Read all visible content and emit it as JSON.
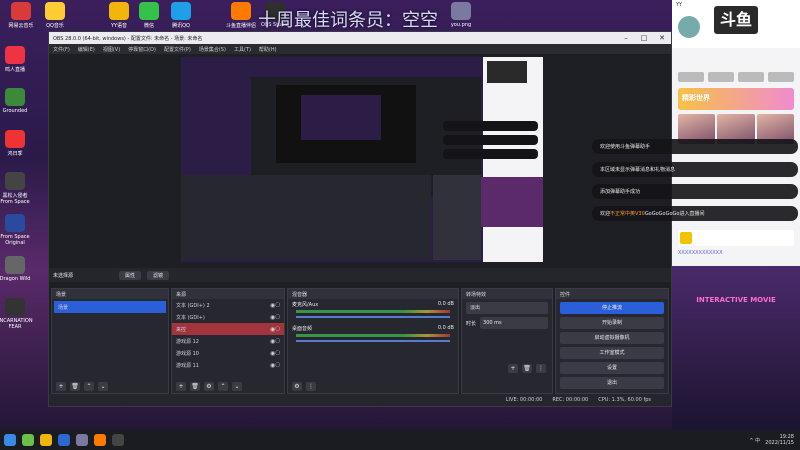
{
  "overlay_title": "十周最佳词条员：空空",
  "desktop_icons": [
    {
      "label": "网易云音乐",
      "color": "#d93a3a"
    },
    {
      "label": "QQ音乐",
      "color": "#ffcc33"
    },
    {
      "label": "YY语音",
      "color": "#f2b50a"
    },
    {
      "label": "微信",
      "color": "#34c24a"
    },
    {
      "label": "腾讯QQ",
      "color": "#1e9fe8"
    },
    {
      "label": "斗鱼直播伴侣",
      "color": "#ff7a00"
    },
    {
      "label": "OBS Studio",
      "color": "#2f2f2f"
    },
    {
      "label": "you.png",
      "color": "#7a7aa0"
    }
  ],
  "left_icons": [
    {
      "label": "鸣人直播",
      "color": "#e34"
    },
    {
      "label": "Grounded",
      "color": "#3a8a3a"
    },
    {
      "label": "鸿日季",
      "color": "#e33"
    },
    {
      "label": "黑松入侵者 From Space",
      "color": "#444"
    },
    {
      "label": "From Space Original",
      "color": "#2a4aa0"
    },
    {
      "label": "Dragon Wild",
      "color": "#666"
    },
    {
      "label": "INCARNATION FEAR",
      "color": "#333"
    }
  ],
  "obs": {
    "title": "OBS 28.0.0 (64-bit, windows) - 配置文件: 未命名 - 场景: 未命名",
    "menu": [
      "文件(F)",
      "编辑(E)",
      "视图(V)",
      "停靠窗口(D)",
      "配置文件(P)",
      "场景集合(S)",
      "工具(T)",
      "帮助(H)"
    ],
    "status_left": "未选择源",
    "status_btn1": "属性",
    "status_btn2": "滤镜",
    "scenes": {
      "title": "场景",
      "items": [
        "场景"
      ]
    },
    "sources": {
      "title": "来源",
      "items": [
        "文本 (GDI+) 2",
        "文本 (GDI+)",
        "来控",
        "游戏源 12",
        "游戏源 10",
        "游戏源 11"
      ]
    },
    "mixer": {
      "title": "混音器",
      "channels": [
        {
          "name": "麦克风/Aux",
          "db": "0.0 dB"
        },
        {
          "name": "桌面音频",
          "db": "0.0 dB"
        }
      ]
    },
    "transitions": {
      "title": "转场特效",
      "type": "淡出",
      "duration_label": "时长",
      "duration": "300 ms"
    },
    "controls": {
      "title": "控件",
      "buttons": [
        "停止推流",
        "开始录制",
        "启动虚拟摄像机",
        "工作室模式",
        "设置",
        "退出"
      ]
    },
    "bottom": {
      "live": "LIVE: 00:00:00",
      "rec": "REC: 00:00:00",
      "cpu": "CPU: 1.3%, 60.00 fps"
    }
  },
  "right_panel": {
    "user": "YY",
    "logo": "斗鱼",
    "banner": "精彩世界",
    "interactive": "INTERACTIVE MOVIE",
    "search_placeholder": "XXXXXXXXXXXXX"
  },
  "chat": [
    {
      "text": "欢迎使用斗鱼弹幕助手"
    },
    {
      "text": "本区域未显示弹幕消息和礼物消息"
    },
    {
      "text": "添加弹幕助手成功"
    },
    {
      "pre": "欢迎",
      "hl": "不正常中英V30",
      "post": "GoGoGoGoGo进入直播间"
    }
  ],
  "taskbar": {
    "time": "19:28",
    "date": "2022/11/15",
    "tray": "^ 中"
  }
}
